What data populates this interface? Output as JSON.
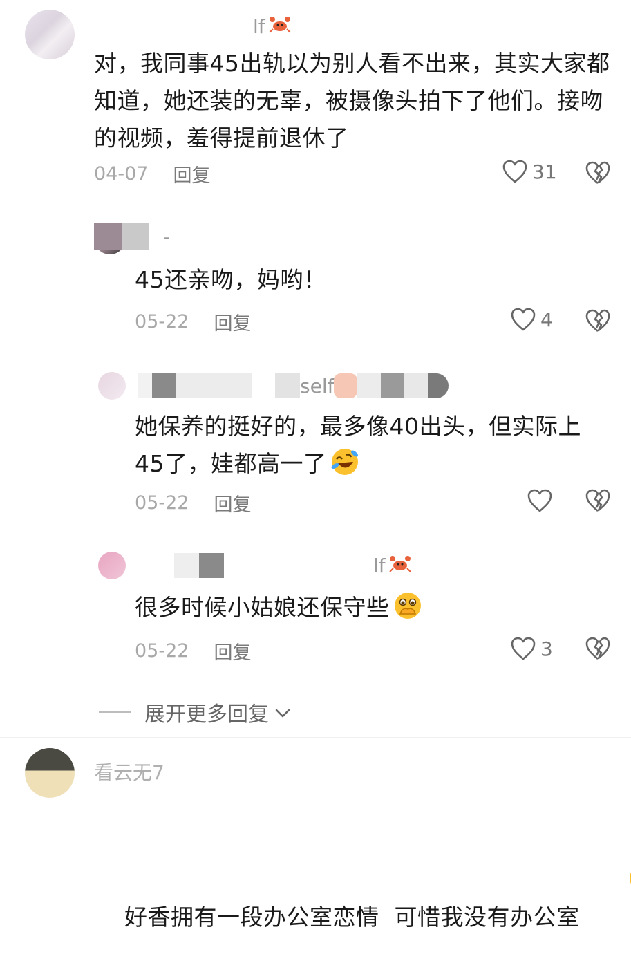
{
  "comments": [
    {
      "username_suffix": "lf",
      "text": "对，我同事45出轨以为别人看不出来，其实大家都知道，她还装的无辜，被摄像头拍下了他们。接吻的视频，羞得提前退休了",
      "date": "04-07",
      "reply_label": "回复",
      "likes": "31"
    },
    {
      "username_suffix": "-",
      "text": "45还亲吻，妈哟！",
      "date": "05-22",
      "reply_label": "回复",
      "likes": "4"
    },
    {
      "username_suffix": "self",
      "text_line1": "她保养的挺好的，最多像40出头，但实际上",
      "text_line2": "45了，娃都高一了",
      "date": "05-22",
      "reply_label": "回复",
      "likes": ""
    },
    {
      "username_suffix": "lf",
      "text": "很多时候小姑娘还保守些",
      "date": "05-22",
      "reply_label": "回复",
      "likes": "3"
    }
  ],
  "expand_label": "展开更多回复",
  "bottom_comment": {
    "username": "看云无7",
    "text": "好香拥有一段办公室恋情  可惜我没有办公室"
  },
  "icons": {
    "like": "heart-outline-icon",
    "dislike": "broken-heart-icon",
    "expand": "chevron-down-icon",
    "crab": "crab-emoji-icon",
    "laugh": "rolling-laugh-emoji-icon",
    "shy": "covering-mouth-emoji-icon",
    "cry": "loudly-crying-emoji-icon"
  }
}
